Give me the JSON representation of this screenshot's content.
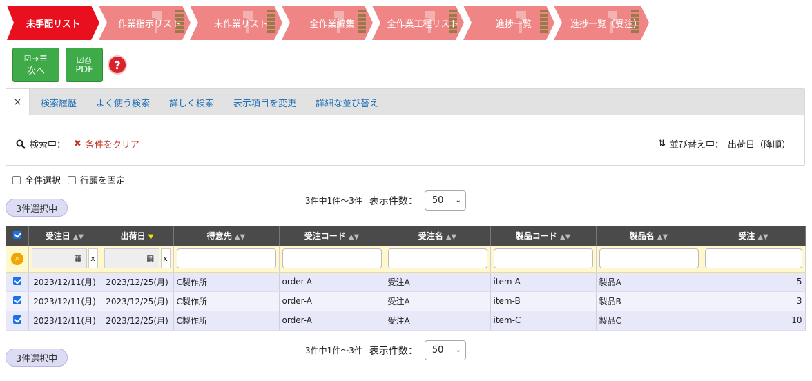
{
  "steps": [
    {
      "label": "未手配リスト",
      "active": true
    },
    {
      "label": "作業指示リスト",
      "active": false
    },
    {
      "label": "未作業リスト",
      "active": false
    },
    {
      "label": "全作業編集",
      "active": false
    },
    {
      "label": "全作業工程リスト",
      "active": false
    },
    {
      "label": "進捗一覧",
      "active": false
    },
    {
      "label": "進捗一覧（受注）",
      "active": false
    }
  ],
  "toolbar": {
    "next_label": "次へ",
    "pdf_label": "PDF",
    "help_label": "?"
  },
  "search_tabs": {
    "close": "×",
    "items": [
      "検索履歴",
      "よく使う検索",
      "詳しく検索",
      "表示項目を変更",
      "詳細な並び替え"
    ]
  },
  "search_state": {
    "label": "検索中：",
    "clear_label": "条件をクリア",
    "sort_label": "並び替え中：",
    "sort_value": "出荷日（降順）"
  },
  "options": {
    "select_all": "全件選択",
    "freeze_header": "行頭を固定"
  },
  "selection_badge": "3件選択中",
  "pager": {
    "count_text": "3件中1件〜3件",
    "per_page_label": "表示件数：",
    "per_page_value": "50"
  },
  "table": {
    "columns": [
      "受注日",
      "出荷日",
      "得意先",
      "受注コード",
      "受注名",
      "製品コード",
      "製品名",
      "受注"
    ],
    "rows": [
      {
        "checked": true,
        "order_date": "2023/12/11(月)",
        "ship_date": "2023/12/25(月)",
        "customer": "C製作所",
        "order_code": "order-A",
        "order_name": "受注A",
        "item_code": "item-A",
        "item_name": "製品A",
        "qty": "5"
      },
      {
        "checked": true,
        "order_date": "2023/12/11(月)",
        "ship_date": "2023/12/25(月)",
        "customer": "C製作所",
        "order_code": "order-A",
        "order_name": "受注A",
        "item_code": "item-B",
        "item_name": "製品B",
        "qty": "3"
      },
      {
        "checked": true,
        "order_date": "2023/12/11(月)",
        "ship_date": "2023/12/25(月)",
        "customer": "C製作所",
        "order_code": "order-A",
        "order_name": "受注A",
        "item_code": "item-C",
        "item_name": "製品C",
        "qty": "10"
      }
    ]
  },
  "colors": {
    "active_step": "#e8101f",
    "inactive_step": "#f08585",
    "button_green": "#3eaa48",
    "link_blue": "#1c6fb7",
    "header_dark": "#4a4a4a",
    "row_selected": "#e8e8fb",
    "filter_row": "#fff8cc"
  }
}
